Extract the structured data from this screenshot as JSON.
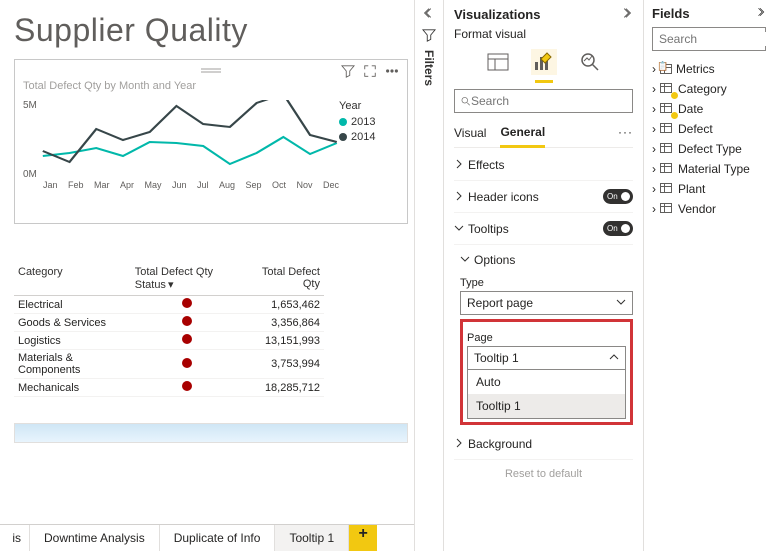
{
  "report": {
    "title": "Supplier Quality",
    "chart": {
      "title": "Total Defect Qty by Month and Year",
      "legend_title": "Year",
      "dot_2013": "#01b8aa",
      "dot_2014": "#374649"
    },
    "table": {
      "h1": "Category",
      "h2": "Total Defect Qty Status",
      "h3": "Total Defect Qty",
      "rows": [
        {
          "c": "Electrical",
          "v": "1,653,462"
        },
        {
          "c": "Goods & Services",
          "v": "3,356,864"
        },
        {
          "c": "Logistics",
          "v": "13,151,993"
        },
        {
          "c": "Materials & Components",
          "v": "3,753,994"
        },
        {
          "c": "Mechanicals",
          "v": "18,285,712"
        }
      ]
    },
    "tabs": {
      "cut": "is",
      "t1": "Downtime Analysis",
      "t2": "Duplicate of Info",
      "t3": "Tooltip 1"
    }
  },
  "chart_data": {
    "type": "line",
    "title": "Total Defect Qty by Month and Year",
    "xlabel": "",
    "ylabel": "",
    "ylim": [
      0,
      5000000
    ],
    "y_ticks": [
      "5M",
      "0M"
    ],
    "categories": [
      "Jan",
      "Feb",
      "Mar",
      "Apr",
      "May",
      "Jun",
      "Jul",
      "Aug",
      "Sep",
      "Oct",
      "Nov",
      "Dec"
    ],
    "series": [
      {
        "name": "2013",
        "color": "#01b8aa",
        "values": [
          1500000,
          1700000,
          2000000,
          1500000,
          2400000,
          2300000,
          2100000,
          1000000,
          1700000,
          2700000,
          1600000,
          2300000
        ]
      },
      {
        "name": "2014",
        "color": "#374649",
        "values": [
          1800000,
          1100000,
          3200000,
          2500000,
          3000000,
          4600000,
          3500000,
          3300000,
          4800000,
          5400000,
          2800000,
          2400000
        ]
      }
    ]
  },
  "filters": {
    "label": "Filters"
  },
  "viz": {
    "title": "Visualizations",
    "sub": "Format visual",
    "search_ph": "Search",
    "tab_visual": "Visual",
    "tab_general": "General",
    "sec_effects": "Effects",
    "sec_header": "Header icons",
    "sec_tooltips": "Tooltips",
    "sub_options": "Options",
    "type_label": "Type",
    "type_value": "Report page",
    "page_label": "Page",
    "page_value": "Tooltip 1",
    "page_opts": {
      "o1": "Auto",
      "o2": "Tooltip 1"
    },
    "sec_bg": "Background",
    "reset": "Reset to default",
    "toggle_on": "On"
  },
  "fields": {
    "title": "Fields",
    "search_ph": "Search",
    "items": {
      "i0": "Metrics",
      "i1": "Category",
      "i2": "Date",
      "i3": "Defect",
      "i4": "Defect Type",
      "i5": "Material Type",
      "i6": "Plant",
      "i7": "Vendor"
    }
  }
}
